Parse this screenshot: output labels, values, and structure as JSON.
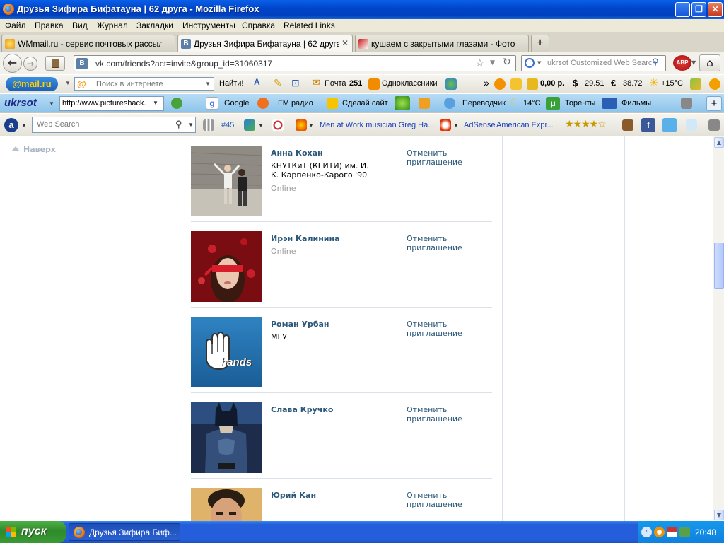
{
  "window": {
    "title": "Друзья Зифира Бифатауна  |  62 друга - Mozilla Firefox"
  },
  "menu": [
    "Файл",
    "Правка",
    "Вид",
    "Журнал",
    "Закладки",
    "Инструменты",
    "Справка",
    "Related Links"
  ],
  "tabs": [
    {
      "label": "WMmail.ru - сервис почтовых рассылок...",
      "active": false
    },
    {
      "label": "Друзья Зифира Бифатауна | 62 друга",
      "active": true
    },
    {
      "label": "кушаем с закрытыми глазами - Фотоко...",
      "active": false
    }
  ],
  "nav": {
    "url": "vk.com/friends?act=invite&group_id=31060317",
    "search_placeholder": "ukrsot Customized Web Search",
    "vk_badge": "B",
    "abp": "ABP"
  },
  "mailru_toolbar": {
    "logo": "@mail.ru",
    "search_placeholder": "Поиск в интернете",
    "find_button": "Найти!",
    "mail_label": "Почта",
    "mail_count": "251",
    "ok_label": "Одноклассники",
    "money": "0,00 р.",
    "usd": "29.51",
    "eur": "38.72",
    "weather": "+15°C"
  },
  "ukrsot_toolbar": {
    "logo": "ukrsot",
    "url_field": "http://www.pictureshack.",
    "google": "Google",
    "radio": "FM радио",
    "make_site": "Сделай сайт",
    "translator": "Переводчик",
    "temp": "14°C",
    "torrents": "Торенты",
    "films": "Фильмы"
  },
  "ask_toolbar": {
    "search_placeholder": "Web Search",
    "rank": "#45",
    "ticker": "Men at Work musician Greg Ha...",
    "adsense": "AdSense",
    "amex": "American Expr..."
  },
  "page": {
    "back_to_top": "Наверх",
    "friends": [
      {
        "name": "Анна Кохан",
        "subtitle": "КНУТКиТ (КГИТИ) им. И. К. Карпенко-Карого '90",
        "online": "Online",
        "cancel": "Отменить приглашение"
      },
      {
        "name": "Ирэн Калинина",
        "subtitle": "",
        "online": "Online",
        "cancel": "Отменить приглашение"
      },
      {
        "name": "Роман Урбан",
        "subtitle": "МГУ",
        "online": "",
        "cancel": "Отменить приглашение",
        "avatar_text": "hands"
      },
      {
        "name": "Слава Кручко",
        "subtitle": "",
        "online": "",
        "cancel": "Отменить приглашение"
      },
      {
        "name": "Юрий Кан",
        "subtitle": "",
        "online": "",
        "cancel": "Отменить приглашение"
      }
    ]
  },
  "taskbar": {
    "start": "пуск",
    "task": "Друзья Зифира Биф...",
    "clock": "20:48"
  }
}
